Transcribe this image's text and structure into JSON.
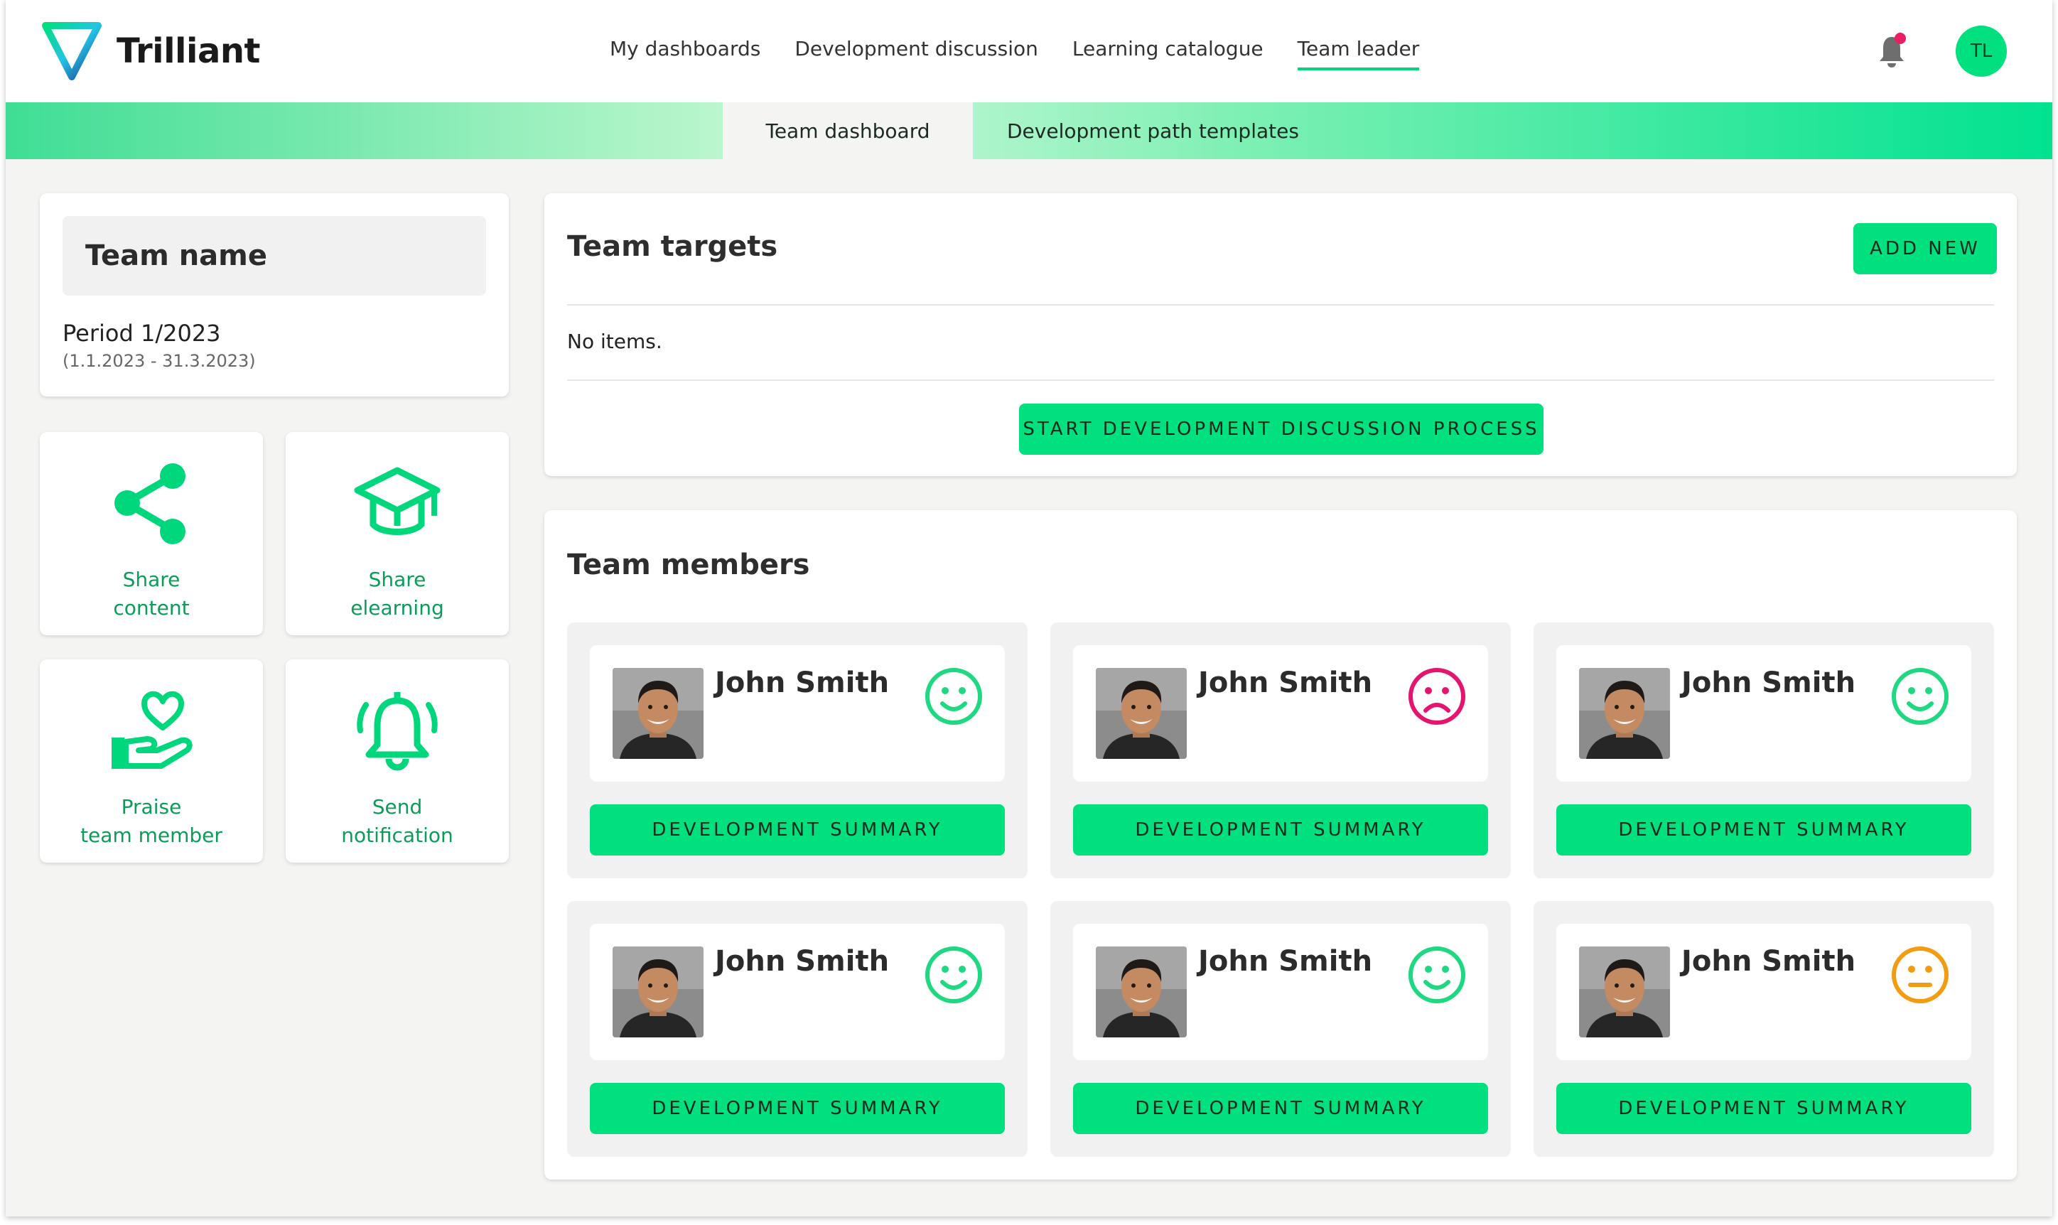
{
  "app": {
    "logo_text": "Trilliant",
    "user_initials": "TL"
  },
  "nav": [
    {
      "label": "My dashboards",
      "active": false
    },
    {
      "label": "Development discussion",
      "active": false
    },
    {
      "label": "Learning catalogue",
      "active": false
    },
    {
      "label": "Team leader",
      "active": true
    }
  ],
  "tabs": [
    {
      "label": "Team dashboard",
      "active": true
    },
    {
      "label": "Development path templates",
      "active": false
    }
  ],
  "team": {
    "name": "Team name",
    "period": "Period 1/2023",
    "range": "(1.1.2023 - 31.3.2023)"
  },
  "actions": [
    {
      "line1": "Share",
      "line2": "content",
      "icon": "share-icon"
    },
    {
      "line1": "Share",
      "line2": "elearning",
      "icon": "graduation-cap-icon"
    },
    {
      "line1": "Praise",
      "line2": "team member",
      "icon": "heart-hand-icon"
    },
    {
      "line1": "Send",
      "line2": "notification",
      "icon": "bell-ring-icon"
    }
  ],
  "targets": {
    "title": "Team targets",
    "add_label": "ADD NEW",
    "empty_text": "No items.",
    "start_label": "START DEVELOPMENT DISCUSSION PROCESS"
  },
  "members": {
    "title": "Team members",
    "button_label": "DEVELOPMENT SUMMARY",
    "items": [
      {
        "name": "John Smith",
        "mood": "happy"
      },
      {
        "name": "John Smith",
        "mood": "sad"
      },
      {
        "name": "John Smith",
        "mood": "happy"
      },
      {
        "name": "John Smith",
        "mood": "happy"
      },
      {
        "name": "John Smith",
        "mood": "happy"
      },
      {
        "name": "John Smith",
        "mood": "neutral"
      }
    ]
  },
  "colors": {
    "accent": "#00e07f",
    "happy": "#1fd882",
    "sad": "#e6136f",
    "neutral": "#f39c12"
  }
}
